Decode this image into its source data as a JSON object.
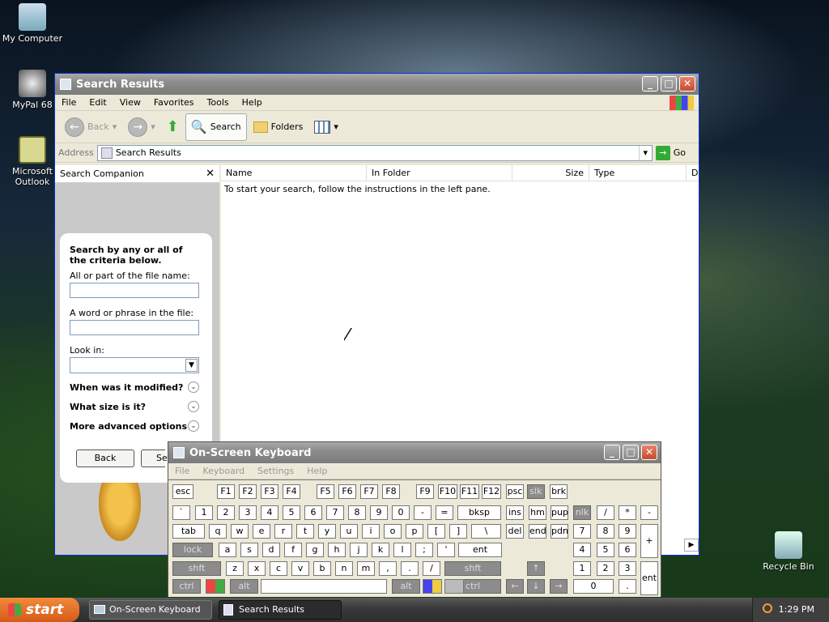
{
  "desktop": {
    "icons": [
      {
        "label": "My Computer"
      },
      {
        "label": "MyPal 68"
      },
      {
        "label": "Microsoft Outlook"
      },
      {
        "label": "Recycle Bin"
      }
    ]
  },
  "explorer": {
    "title": "Search Results",
    "menu": [
      "File",
      "Edit",
      "View",
      "Favorites",
      "Tools",
      "Help"
    ],
    "toolbar": {
      "back": "Back",
      "search": "Search",
      "folders": "Folders"
    },
    "address": {
      "label": "Address",
      "value": "Search Results",
      "go": "Go"
    },
    "companion": {
      "title": "Search Companion",
      "heading": "Search by any or all of the criteria below.",
      "file_name_label": "All or part of the file name:",
      "phrase_label": "A word or phrase in the file:",
      "look_in_label": "Look in:",
      "modified": "When was it modified?",
      "size": "What size is it?",
      "advanced": "More advanced options",
      "back_button": "Back",
      "search_button": "Se"
    },
    "columns": [
      "Name",
      "In Folder",
      "Size",
      "Type",
      "D"
    ],
    "message": "To start your search, follow the instructions in the left pane."
  },
  "osk": {
    "title": "On-Screen Keyboard",
    "menu": [
      "File",
      "Keyboard",
      "Settings",
      "Help"
    ],
    "rows": {
      "fn": [
        "esc",
        "F1",
        "F2",
        "F3",
        "F4",
        "F5",
        "F6",
        "F7",
        "F8",
        "F9",
        "F10",
        "F11",
        "F12",
        "psc",
        "slk",
        "brk"
      ],
      "num": [
        "`",
        "1",
        "2",
        "3",
        "4",
        "5",
        "6",
        "7",
        "8",
        "9",
        "0",
        "-",
        "=",
        "bksp",
        "ins",
        "hm",
        "pup",
        "nlk",
        "/",
        "*",
        "-"
      ],
      "tab": [
        "tab",
        "q",
        "w",
        "e",
        "r",
        "t",
        "y",
        "u",
        "i",
        "o",
        "p",
        "[",
        "]",
        "\\",
        "del",
        "end",
        "pdn",
        "7",
        "8",
        "9",
        "+"
      ],
      "caps": [
        "lock",
        "a",
        "s",
        "d",
        "f",
        "g",
        "h",
        "j",
        "k",
        "l",
        ";",
        "'",
        "ent",
        "4",
        "5",
        "6"
      ],
      "shift": [
        "shft",
        "z",
        "x",
        "c",
        "v",
        "b",
        "n",
        "m",
        ",",
        ".",
        "/",
        "shft",
        "↑",
        "1",
        "2",
        "3",
        "ent"
      ],
      "ctrl": [
        "ctrl",
        "alt",
        "alt",
        "ctrl",
        "←",
        "↓",
        "→",
        "0",
        "."
      ]
    }
  },
  "taskbar": {
    "start": "start",
    "items": [
      "On-Screen Keyboard",
      "Search Results"
    ],
    "clock": "1:29 PM"
  }
}
